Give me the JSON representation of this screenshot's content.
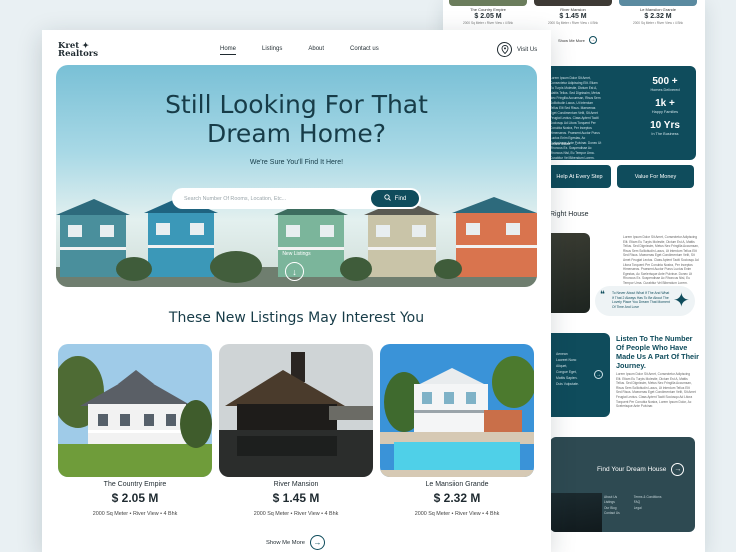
{
  "back": {
    "top_cards": [
      {
        "name": "The Country Empire",
        "price": "$ 2.05 M",
        "meta": "2000 Sq Meter  •  River View  •  4 Bhk"
      },
      {
        "name": "River Mansion",
        "price": "$ 1.45 M",
        "meta": "2000 Sq Meter  •  River View  •  4 Bhk"
      },
      {
        "name": "Le Mansiion Grande",
        "price": "$ 2.32 M",
        "meta": "2000 Sq Meter  •  River View  •  4 Bhk"
      }
    ],
    "show_more": "Show Me More",
    "stats_text": "Lorem Ipsum Dolor Sit Amet, Consectetur Adipiscing Elit. Etiam Eu Turpis Molestie, Dictum Est A, Mattis Tellus. Sed Dignissim, Metus Nec Fringilla Accumsan, Risus Sem Sollicitudin Lacus, Ut Interdum Tellus Elit Sed Risus. Maecenas Eget Condimentum Velit, Sit Amet Feugiat Lectus. Class Aptent Taciti Sociosqu Ad Litora Torquent Per Conubia Nostra, Per Inceptos Himenaeos. Praesent Auctor Purus Luctus Enim Egestas, Ac Scelerisque Ante Pulvinar. Donec Ut Rhoncus Ex. Suspendisse Ac Rhoncus Nisl, Eu Tempor Urna. Curabitur Vel Bibendum Lorem.",
    "stats_more": "Learn More",
    "stats": [
      {
        "num": "500 +",
        "label": "Homes Delivered"
      },
      {
        "num": "1k +",
        "label": "Happy Families"
      },
      {
        "num": "10 Yrs",
        "label": "In The Business"
      }
    ],
    "btn_help": "Help At Every Step",
    "btn_value": "Value For Money",
    "right_house": "Right House",
    "rh_text": "Lorem Ipsum Dolor Sit Amet, Consectetur Adipiscing Elit. Etiam Eu Turpis Molestie, Dictum Est A, Mattis Tellus. Sed Dignissim, Metus Nec Fringilla Accumsan, Risus Sem Sollicitudin Lacus, Ut Interdum Tellus Elit Sed Risus. Maecenas Eget Condimentum Velit, Sit Amet Feugiat Lectus. Class Aptent Taciti Sociosqu Ad Litora Torquent Per Conubia Nostra, Per Inceptos Himenaeos. Praesent Auctor Purus Luctus Enim Egestas, Ac Scelerisque Ante Pulvinar. Donec Ut Rhoncus Ex. Suspendisse Ac Rhoncus Nisl, Eu Tempor Urna. Curabitur Vel Bibendum Lorem.",
    "quote": "To Never About What If The And What If That 2 Always Has To Be About The Lovely Place You Dream That Moment Of Time And Love",
    "teal_text": "Aenean Laoreet Nunc Aliquet, Congue Eget, Mattis Sapien. Duis Vulputate.",
    "listen_title": "Listen To The Number Of People Who Have Made Us A Part Of Their Journey.",
    "listen_text": "Lorem Ipsum Dolor Sit Amet, Consectetur Adipiscing Elit. Etiam Eu Turpis Molestie, Dictum Est A, Mattis Tellus. Sed Dignissim, Metus Nec Fringilla Accumsan, Risus Sem Sollicitudin Lacus, Ut Interdum Tellus Elit Sed Risus. Maecenas Eget Condimentum Velit, Sit Amet Feugiat Lectus. Class Aptent Taciti Sociosqu Ad Litora Torquent Per Conubia Nostra, Lorem Ipsum Dolor, Ac Scelerisque Ante Pulvinar.",
    "find_dream": "Find Your Dream House",
    "links_a": [
      "About Us",
      "Listings",
      "Our Blog",
      "Contact Us"
    ],
    "links_b": [
      "Terms & Conditions",
      "FAQ",
      "Legal"
    ]
  },
  "nav": {
    "logo": "Kret",
    "logo_sub": "Realtors",
    "links": [
      "Home",
      "Listings",
      "About",
      "Contact us"
    ],
    "visit": "Visit Us"
  },
  "hero": {
    "title_1": "Still Looking For That",
    "title_2": "Dream Home?",
    "subtitle": "We're Sure You'll Find It Here!",
    "search_placeholder": "Search Number Of Rooms, Location, Etc...",
    "find_label": "Find",
    "new_listings": "New Listings"
  },
  "listings": {
    "title": "These New Listings May Interest You",
    "cards": [
      {
        "name": "The Country Empire",
        "price": "$ 2.05 M",
        "meta": "2000 Sq Meter  •  River View  •  4 Bhk"
      },
      {
        "name": "River Mansion",
        "price": "$ 1.45 M",
        "meta": "2000 Sq Meter  •  River View  •  4 Bhk"
      },
      {
        "name": "Le Mansiion Grande",
        "price": "$ 2.32 M",
        "meta": "2000 Sq Meter  •  River View  •  4 Bhk"
      }
    ],
    "show_more": "Show Me More"
  },
  "colors": {
    "primary": "#0f4c5c",
    "text": "#1f2a30",
    "background": "#e9f0f3"
  }
}
